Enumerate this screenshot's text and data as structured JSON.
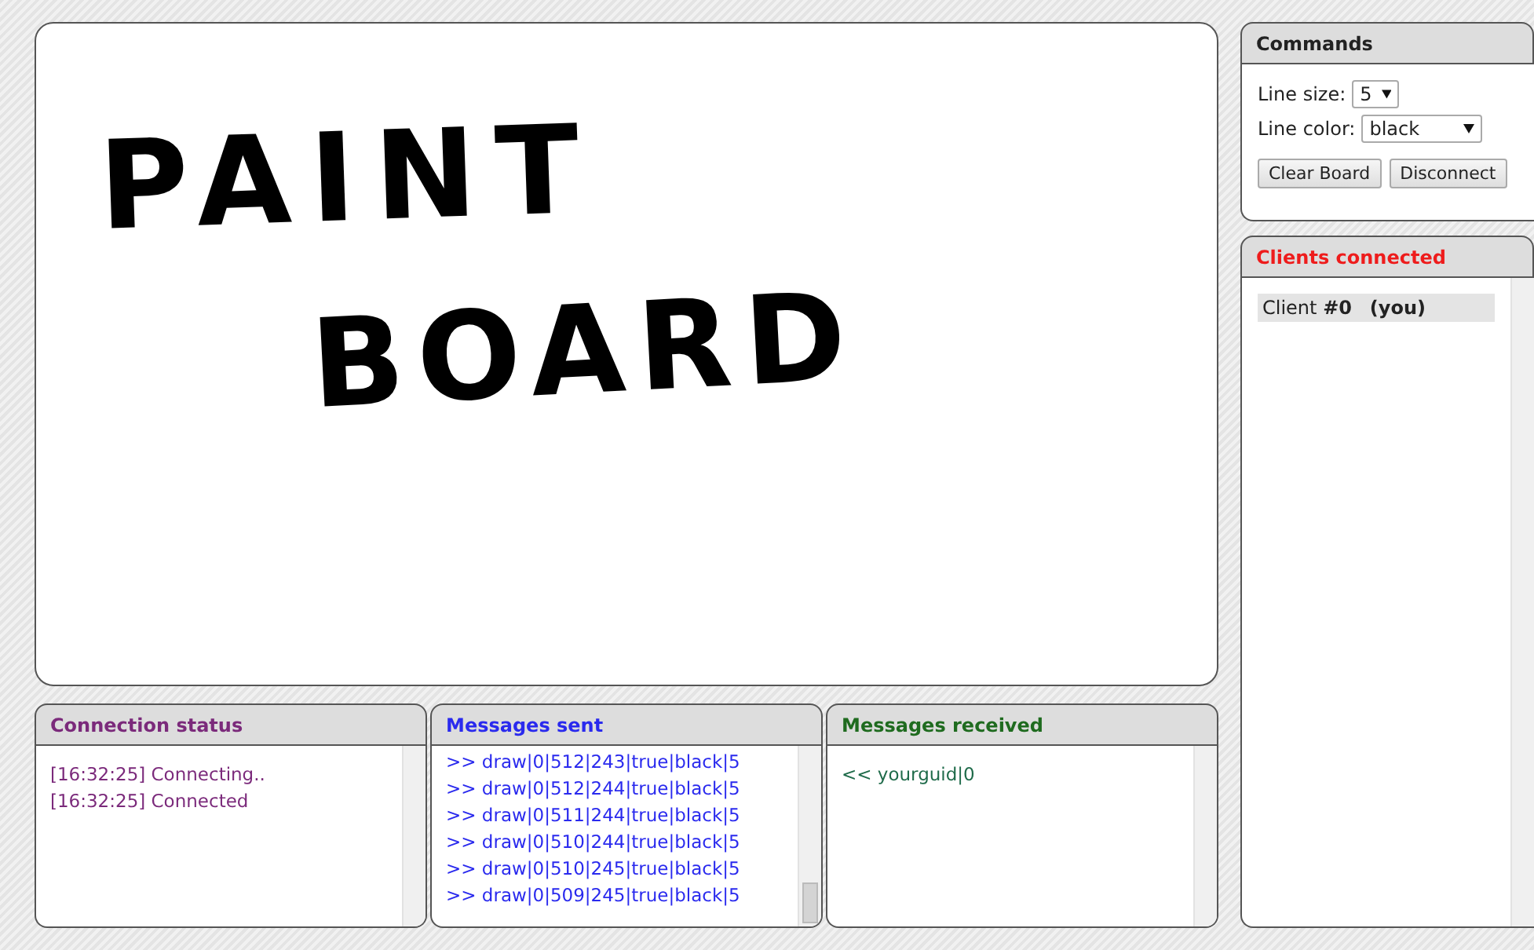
{
  "board": {
    "writing": [
      {
        "text": "PAINT"
      },
      {
        "text": "BOARD"
      }
    ]
  },
  "panels": [
    {
      "title": "Connection status",
      "kind": "status",
      "scrolled": false,
      "lines": [
        "[16:32:25] Connecting..",
        "[16:32:25] Connected"
      ]
    },
    {
      "title": "Messages sent",
      "kind": "sent",
      "scrolled": true,
      "lines": [
        ">> draw|0|512|243|true|black|5",
        ">> draw|0|512|244|true|black|5",
        ">> draw|0|511|244|true|black|5",
        ">> draw|0|510|244|true|black|5",
        ">> draw|0|510|245|true|black|5",
        ">> draw|0|509|245|true|black|5"
      ]
    },
    {
      "title": "Messages received",
      "kind": "received",
      "scrolled": false,
      "lines": [
        "<< yourguid|0"
      ]
    }
  ],
  "commands": {
    "title": "Commands",
    "line_size": {
      "label": "Line size:",
      "value": "5"
    },
    "line_color": {
      "label": "Line color:",
      "value": "black"
    },
    "buttons": [
      "Clear Board",
      "Disconnect"
    ]
  },
  "clients": {
    "title": "Clients connected",
    "items": [
      {
        "label": "Client **#0**   **(you)**",
        "selected": true
      }
    ]
  }
}
